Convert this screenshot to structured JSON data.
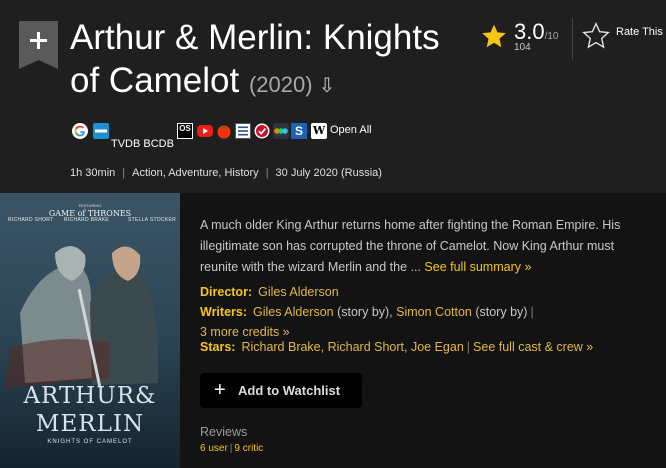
{
  "title": {
    "text": "Arthur & Merlin: Knights of Camelot",
    "year": "(2020)",
    "menu_glyph": "⇩"
  },
  "rating": {
    "score": "3.0",
    "out_of": "/10",
    "votes": "104",
    "rate_label": "Rate This"
  },
  "external_links": {
    "tvdb_bcdb": "TVDB BCDB",
    "os_label": "OS",
    "s_label": "S",
    "w_label": "W",
    "open_all": "Open All",
    "icons": [
      "google-icon",
      "bing-icon",
      "opensubtitles-icon",
      "youtube-icon",
      "rotten-tomatoes-icon",
      "list-icon",
      "letterboxd-icon",
      "multi-dot-icon",
      "s-icon",
      "wikipedia-icon"
    ]
  },
  "meta": {
    "runtime": "1h 30min",
    "genres": "Action, Adventure, History",
    "release": "30 July 2020 (Russia)"
  },
  "poster": {
    "featuring": "FEATURING",
    "franchise": "GAME of THRONES",
    "credit_1": "RICHARD SHORT",
    "credit_2": "RICHARD BRAKE",
    "credit_3": "STELLA STOCKER",
    "title_line_1": "ARTHUR&",
    "title_line_2": "MERLIN",
    "subtitle": "KNIGHTS OF CAMELOT"
  },
  "summary": {
    "text": "A much older King Arthur returns home after fighting the Roman Empire. His illegitimate son has corrupted the throne of Camelot. Now King Arthur must reunite with the wizard Merlin and the ... ",
    "more_link": "See full summary »"
  },
  "credits": {
    "director_label": "Director:",
    "director": "Giles Alderson",
    "writers_label": "Writers:",
    "writer_1": "Giles Alderson",
    "writer_1_role": " (story by), ",
    "writer_2": "Simon Cotton",
    "writer_2_role": " (story by)",
    "writers_more": "3 more credits »",
    "stars_label": "Stars:",
    "stars": "Richard Brake, Richard Short, Joe Egan",
    "cast_link": "See full cast & crew »"
  },
  "watchlist": {
    "plus": "+",
    "label": "Add to Watchlist"
  },
  "reviews": {
    "title": "Reviews",
    "user": "6 user",
    "critic": "9 critic"
  },
  "colors": {
    "accent": "#f5c518",
    "background_top": "#1f1f1f",
    "background_bottom": "#131313"
  }
}
